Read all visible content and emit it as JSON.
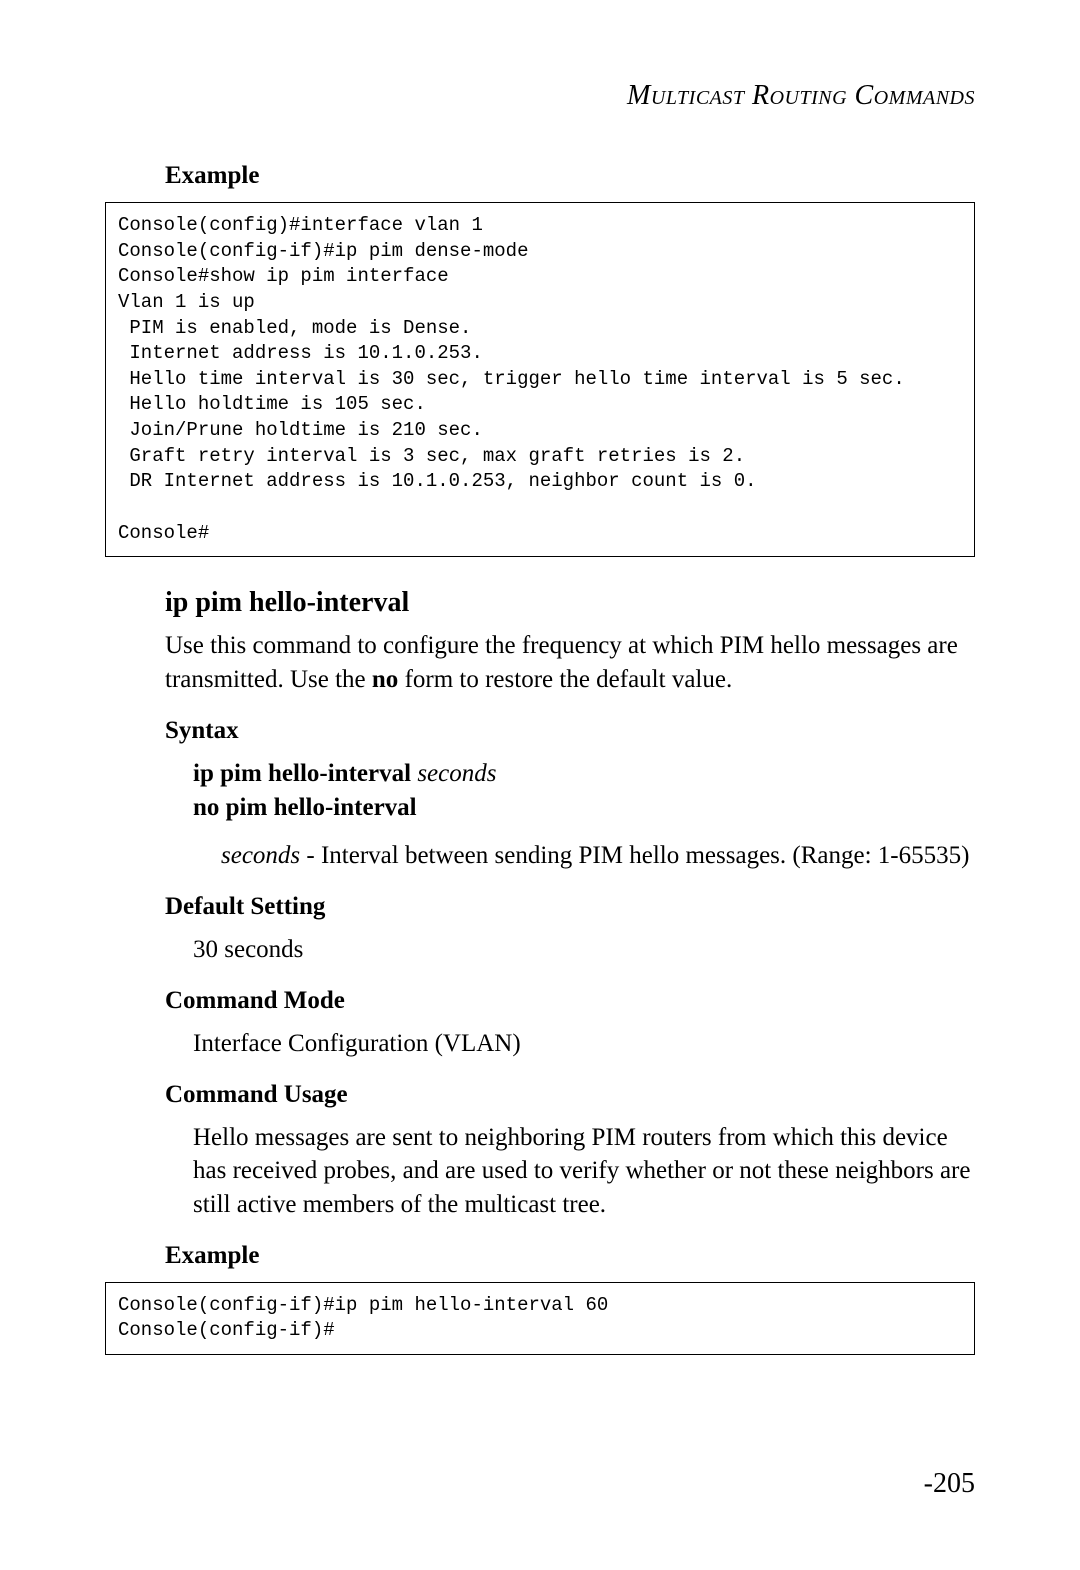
{
  "header": {
    "title": "Multicast Routing Commands"
  },
  "section1": {
    "heading": "Example",
    "code": "Console(config)#interface vlan 1\nConsole(config-if)#ip pim dense-mode\nConsole#show ip pim interface\nVlan 1 is up\n PIM is enabled, mode is Dense.\n Internet address is 10.1.0.253.\n Hello time interval is 30 sec, trigger hello time interval is 5 sec.\n Hello holdtime is 105 sec.\n Join/Prune holdtime is 210 sec.\n Graft retry interval is 3 sec, max graft retries is 2.\n DR Internet address is 10.1.0.253, neighbor count is 0.\n\nConsole#"
  },
  "section2": {
    "title": "ip pim hello-interval",
    "description_part1": "Use this command to configure the frequency at which PIM hello messages are transmitted. Use the ",
    "description_bold": "no",
    "description_part2": " form to restore the default value.",
    "syntax": {
      "heading": "Syntax",
      "line1_bold": "ip pim hello-interval",
      "line1_italic": " seconds",
      "line2_bold": "no pim hello-interval",
      "param_italic": "seconds",
      "param_text": " - Interval between sending PIM hello messages. (Range: 1-65535)"
    },
    "default_setting": {
      "heading": "Default Setting",
      "value": "30 seconds"
    },
    "command_mode": {
      "heading": "Command Mode",
      "value": "Interface Configuration (VLAN)"
    },
    "command_usage": {
      "heading": "Command Usage",
      "value": "Hello messages are sent to neighboring PIM routers from which this device has received probes, and are used to verify whether or not these neighbors are still active members of the multicast tree."
    },
    "example": {
      "heading": "Example",
      "code": "Console(config-if)#ip pim hello-interval 60\nConsole(config-if)#"
    }
  },
  "page_number": "-205"
}
